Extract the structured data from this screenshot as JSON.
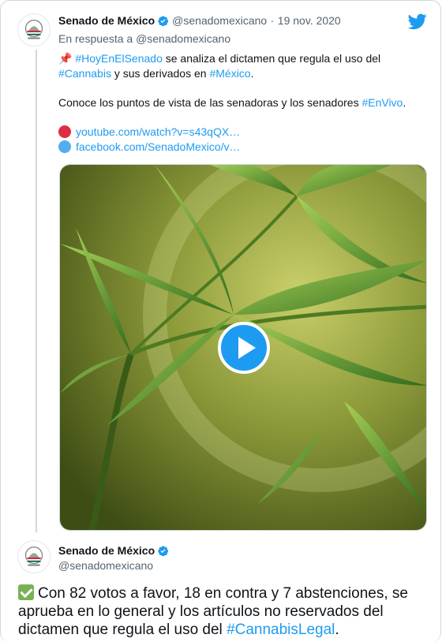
{
  "tweet1": {
    "name": "Senado de México",
    "handle": "@senadomexicano",
    "separator": "·",
    "date": "19 nov. 2020",
    "reply_prefix": "En respuesta a",
    "reply_handle": "@senadomexicano",
    "pin_emoji": "📌",
    "line1_tag": "#HoyEnElSenado",
    "line1_text": " se analiza el dictamen que regula el uso del",
    "line2_tag": "#Cannabis",
    "line2_text": " y sus derivados en ",
    "line2_tag2": "#México",
    "line2_end": ".",
    "line3_text": "Conoce los puntos de vista de las senadoras y los senadores ",
    "line3_tag": "#EnVivo",
    "line3_end": ".",
    "link1": "youtube.com/watch?v=s43qQX…",
    "link2": "facebook.com/SenadoMexico/v…",
    "media_type": "video"
  },
  "tweet2": {
    "name": "Senado de México",
    "handle": "@senadomexicano",
    "text": "Con 82 votos a favor, 18 en contra y 7 abstenciones, se aprueba en lo general y los artículos no reservados del dictamen que regula el uso del ",
    "tag": "#CannabisLegal",
    "end": "."
  },
  "icons": {
    "twitter": "twitter-bird-icon",
    "verified": "verified-badge-icon",
    "play": "play-icon",
    "check": "check-mark-icon"
  },
  "colors": {
    "accent": "#1d9bf0",
    "text": "#0f1419",
    "muted": "#536471",
    "youtube_dot": "#dd2e44",
    "facebook_dot": "#55acee",
    "check": "#77b255"
  }
}
